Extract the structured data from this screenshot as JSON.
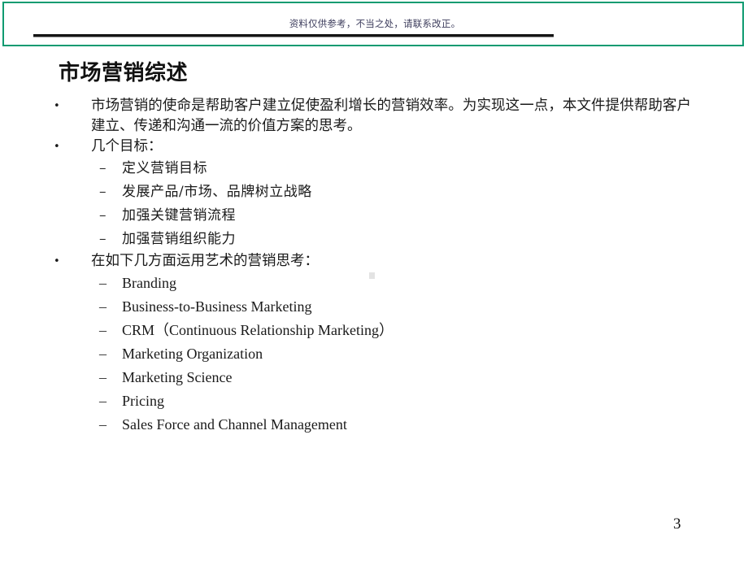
{
  "slide": {
    "page_number": "3",
    "title": "市场营销综述",
    "header_note": "资料仅供参考，不当之处，请联系改正。",
    "accent_green": "#0f9b71",
    "rule_color": "#151515",
    "text_color": "#1a1a1a",
    "note_color": "#3c3c5c",
    "background": "#ffffff"
  },
  "content": {
    "blocks": [
      {
        "level": 1,
        "marker": "•",
        "script": "cjk",
        "text": "市场营销的使命是帮助客户建立促使盈利增长的营销效率。为实现这一点，本文件提供帮助客户建立、传递和沟通一流的价值方案的思考。"
      },
      {
        "level": 1,
        "marker": "•",
        "script": "cjk",
        "text": "几个目标："
      },
      {
        "level": 2,
        "marker": "–",
        "script": "cjk",
        "text": "定义营销目标"
      },
      {
        "level": 2,
        "marker": "–",
        "script": "cjk",
        "text": "发展产品/市场、品牌树立战略"
      },
      {
        "level": 2,
        "marker": "–",
        "script": "cjk",
        "text": "加强关键营销流程"
      },
      {
        "level": 2,
        "marker": "–",
        "script": "cjk",
        "text": "加强营销组织能力"
      },
      {
        "level": 1,
        "marker": "•",
        "script": "cjk",
        "text": "在如下几方面运用艺术的营销思考："
      },
      {
        "level": 2,
        "marker": "–",
        "script": "latin",
        "text": "Branding"
      },
      {
        "level": 2,
        "marker": "–",
        "script": "latin",
        "text": "Business-to-Business Marketing"
      },
      {
        "level": 2,
        "marker": "–",
        "script": "latin",
        "text": "CRM（Continuous Relationship Marketing）"
      },
      {
        "level": 2,
        "marker": "–",
        "script": "latin",
        "text": "Marketing Organization"
      },
      {
        "level": 2,
        "marker": "–",
        "script": "latin",
        "text": "Marketing Science"
      },
      {
        "level": 2,
        "marker": "–",
        "script": "latin",
        "text": "Pricing"
      },
      {
        "level": 2,
        "marker": "–",
        "script": "latin",
        "text": "Sales Force and Channel Management"
      }
    ]
  }
}
